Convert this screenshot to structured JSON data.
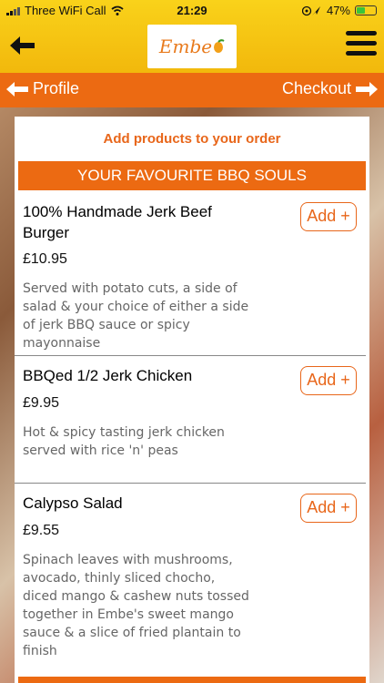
{
  "status_bar": {
    "carrier": "Three WiFi Call",
    "time": "21:29",
    "battery": "47%",
    "icons": [
      "signal-bars-icon",
      "wifi-icon",
      "location-icon",
      "battery-charging-icon"
    ]
  },
  "header": {
    "logo_text": "Embe",
    "back_icon": "arrow-left-icon",
    "menu_icon": "hamburger-menu-icon"
  },
  "nav": {
    "left_label": "Profile",
    "right_label": "Checkout"
  },
  "panel": {
    "title": "Add products to your order",
    "category": "YOUR FAVOURITE BBQ SOULS"
  },
  "items": [
    {
      "name": "100% Handmade Jerk Beef Burger",
      "price": "£10.95",
      "description": "Served with potato cuts, a side of salad & your choice of either a side of jerk BBQ sauce or spicy mayonnaise",
      "add_label": "Add +"
    },
    {
      "name": "BBQed  1/2  Jerk Chicken",
      "price": "£9.95",
      "description": "Hot & spicy tasting jerk chicken served with rice 'n' peas",
      "add_label": "Add +"
    },
    {
      "name": "Calypso Salad",
      "price": "£9.55",
      "description": "Spinach leaves with mushrooms, avocado, thinly sliced chocho, diced mango & cashew nuts tossed together in Embe's sweet mango sauce & a slice of fried plantain to finish",
      "add_label": "Add +"
    }
  ],
  "colors": {
    "yellow": "#f2b80c",
    "orange": "#ec6a12",
    "accent_text": "#e8661a"
  }
}
